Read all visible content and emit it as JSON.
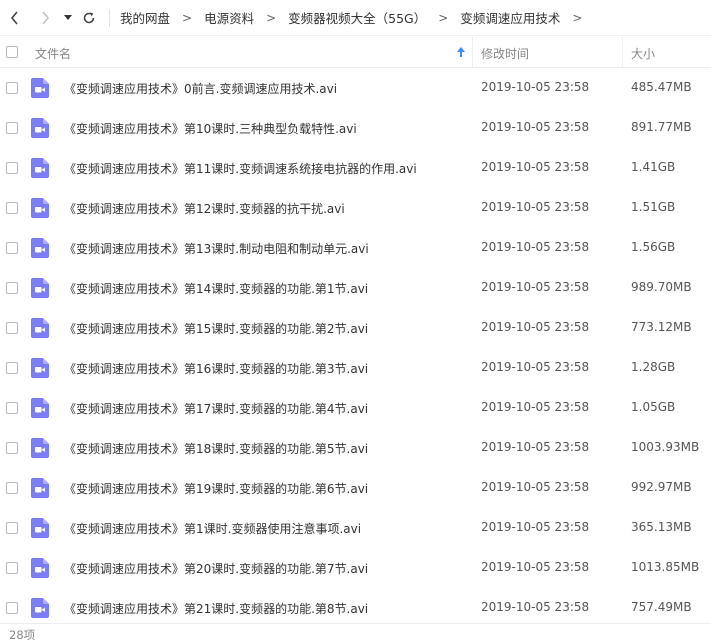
{
  "nav": {
    "back_icon": "chevron-left-icon",
    "forward_icon": "chevron-right-icon",
    "dropdown_icon": "caret-down-icon",
    "refresh_icon": "refresh-icon"
  },
  "breadcrumb": [
    {
      "label": "我的网盘"
    },
    {
      "label": "电源资料"
    },
    {
      "label": "变频器视频大全（55G）"
    },
    {
      "label": "变频调速应用技术"
    }
  ],
  "breadcrumb_separator": ">",
  "columns": {
    "name": "文件名",
    "modified": "修改时间",
    "size": "大小"
  },
  "colors": {
    "file_icon": "#7b7ef2",
    "border": "#eeeeee",
    "muted_text": "#888888"
  },
  "files": [
    {
      "name": "《变频调速应用技术》0前言.变频调速应用技术.avi",
      "modified": "2019-10-05 23:58",
      "size": "485.47MB"
    },
    {
      "name": "《变频调速应用技术》第10课时.三种典型负载特性.avi",
      "modified": "2019-10-05 23:58",
      "size": "891.77MB"
    },
    {
      "name": "《变频调速应用技术》第11课时.变频调速系统接电抗器的作用.avi",
      "modified": "2019-10-05 23:58",
      "size": "1.41GB"
    },
    {
      "name": "《变频调速应用技术》第12课时.变频器的抗干扰.avi",
      "modified": "2019-10-05 23:58",
      "size": "1.51GB"
    },
    {
      "name": "《变频调速应用技术》第13课时.制动电阻和制动单元.avi",
      "modified": "2019-10-05 23:58",
      "size": "1.56GB"
    },
    {
      "name": "《变频调速应用技术》第14课时.变频器的功能.第1节.avi",
      "modified": "2019-10-05 23:58",
      "size": "989.70MB"
    },
    {
      "name": "《变频调速应用技术》第15课时.变频器的功能.第2节.avi",
      "modified": "2019-10-05 23:58",
      "size": "773.12MB"
    },
    {
      "name": "《变频调速应用技术》第16课时.变频器的功能.第3节.avi",
      "modified": "2019-10-05 23:58",
      "size": "1.28GB"
    },
    {
      "name": "《变频调速应用技术》第17课时.变频器的功能.第4节.avi",
      "modified": "2019-10-05 23:58",
      "size": "1.05GB"
    },
    {
      "name": "《变频调速应用技术》第18课时.变频器的功能.第5节.avi",
      "modified": "2019-10-05 23:58",
      "size": "1003.93MB"
    },
    {
      "name": "《变频调速应用技术》第19课时.变频器的功能.第6节.avi",
      "modified": "2019-10-05 23:58",
      "size": "992.97MB"
    },
    {
      "name": "《变频调速应用技术》第1课时.变频器使用注意事项.avi",
      "modified": "2019-10-05 23:58",
      "size": "365.13MB"
    },
    {
      "name": "《变频调速应用技术》第20课时.变频器的功能.第7节.avi",
      "modified": "2019-10-05 23:58",
      "size": "1013.85MB"
    },
    {
      "name": "《变频调速应用技术》第21课时.变频器的功能.第8节.avi",
      "modified": "2019-10-05 23:58",
      "size": "757.49MB"
    }
  ],
  "footer": {
    "count_label": "28项"
  }
}
